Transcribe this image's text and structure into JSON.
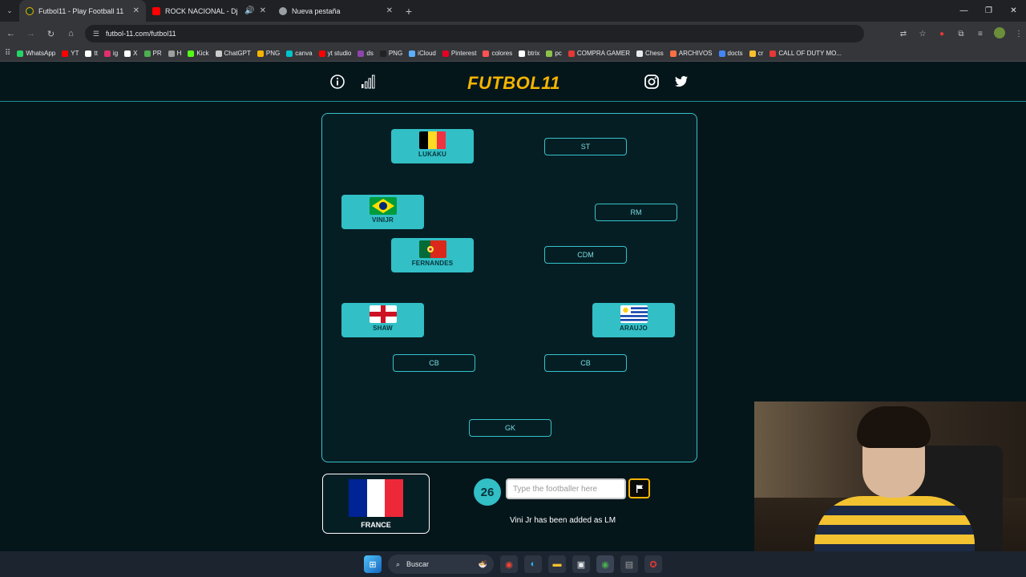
{
  "browser": {
    "tabs": [
      {
        "title": "Futbol11 - Play Football 11",
        "favicon_color": "#1b3a2e"
      },
      {
        "title": "ROCK NACIONAL - Dj Seb",
        "favicon_color": "#ff0000"
      },
      {
        "title": "Nueva pestaña",
        "favicon_color": "#9aa0a6"
      }
    ],
    "url": "futbol-11.com/futbol11",
    "bookmarks": [
      {
        "label": "WhatsApp",
        "color": "#25d366"
      },
      {
        "label": "YT",
        "color": "#ff0000"
      },
      {
        "label": "tt",
        "color": "#ffffff"
      },
      {
        "label": "ig",
        "color": "#e1306c"
      },
      {
        "label": "X",
        "color": "#ffffff"
      },
      {
        "label": "PR",
        "color": "#4caf50"
      },
      {
        "label": "H",
        "color": "#9e9e9e"
      },
      {
        "label": "Kick",
        "color": "#53fc18"
      },
      {
        "label": "ChatGPT",
        "color": "#cccccc"
      },
      {
        "label": "PNG",
        "color": "#f5b400"
      },
      {
        "label": "canva",
        "color": "#00c4cc"
      },
      {
        "label": "yt studio",
        "color": "#ff0000"
      },
      {
        "label": "ds",
        "color": "#8e44ad"
      },
      {
        "label": "PNG",
        "color": "#222222"
      },
      {
        "label": "iCloud",
        "color": "#5ab0ff"
      },
      {
        "label": "Pinterest",
        "color": "#e60023"
      },
      {
        "label": "colores",
        "color": "#ff5252"
      },
      {
        "label": "btrix",
        "color": "#ffffff"
      },
      {
        "label": "pc",
        "color": "#8bc34a"
      },
      {
        "label": "COMPRA GAMER",
        "color": "#e53935"
      },
      {
        "label": "Chess",
        "color": "#e8eaed"
      },
      {
        "label": "ARCHIVOS",
        "color": "#ff7043"
      },
      {
        "label": "docts",
        "color": "#4285f4"
      },
      {
        "label": "cr",
        "color": "#fbc02d"
      },
      {
        "label": "CALL OF DUTY MO...",
        "color": "#e53935"
      }
    ]
  },
  "site": {
    "logo": "FUTBOL11",
    "icons": [
      "info-icon",
      "stats-icon",
      "instagram-icon",
      "twitter-icon"
    ]
  },
  "pitch": {
    "empty_slots": {
      "st": "ST",
      "rm": "RM",
      "cdm": "CDM",
      "cb_left": "CB",
      "cb_right": "CB",
      "gk": "GK"
    },
    "players": {
      "lukaku": {
        "name": "LUKAKU",
        "country": "Belgium"
      },
      "vinijr": {
        "name": "VINIJR",
        "country": "Brazil"
      },
      "fernandes": {
        "name": "FERNANDES",
        "country": "Portugal"
      },
      "shaw": {
        "name": "SHAW",
        "country": "England"
      },
      "araujo": {
        "name": "ARAUJO",
        "country": "Uruguay"
      }
    }
  },
  "team": {
    "name": "FRANCE"
  },
  "game": {
    "counter": "26",
    "input_placeholder": "Type the footballer here",
    "input_value": "",
    "status_message": "Vini Jr has been added as LM"
  },
  "taskbar": {
    "search_label": "Buscar"
  }
}
